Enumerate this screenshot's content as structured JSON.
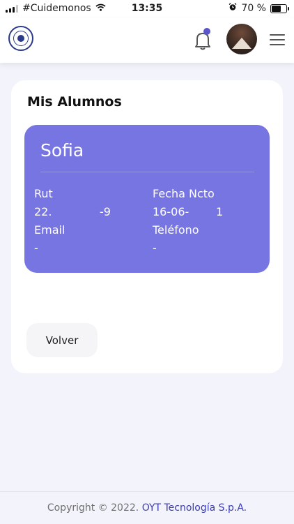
{
  "status_bar": {
    "carrier": "#Cuidemonos",
    "time": "13:35",
    "battery": "70 %",
    "battery_level": 0.7
  },
  "header": {
    "logo_icon": "school-crest-icon",
    "bell_icon": "bell-icon",
    "menu_icon": "hamburger-menu-icon"
  },
  "main": {
    "title": "Mis Alumnos",
    "student": {
      "name": "Sofia",
      "rut_label": "Rut",
      "rut_value_start": "22.",
      "rut_value_end": "-9",
      "birth_label": "Fecha Ncto",
      "birth_value_start": "16-06-",
      "birth_value_end": "1",
      "email_label": "Email",
      "email_value": "-",
      "phone_label": "Teléfono",
      "phone_value": "-"
    },
    "back_button": "Volver"
  },
  "footer": {
    "copyright": "Copyright © 2022.",
    "company": "OYT Tecnología S.p.A."
  },
  "colors": {
    "accent": "#7775e2",
    "brand_link": "#3b3bb0",
    "notification_dot": "#5a55c9",
    "background": "#f3f4fb"
  }
}
